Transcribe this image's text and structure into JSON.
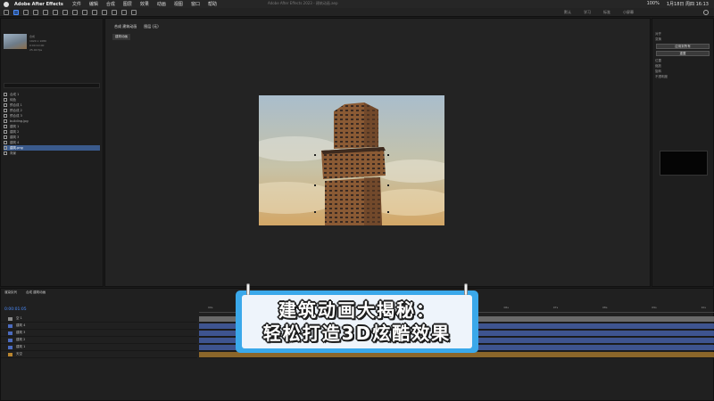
{
  "menubar": {
    "app_name": "Adobe After Effects",
    "items": [
      "文件",
      "编辑",
      "合成",
      "图层",
      "效果",
      "动画",
      "视图",
      "窗口",
      "帮助"
    ],
    "window_title": "Adobe After Effects 2023 - 建筑动画.aep",
    "right_items": [
      "100%",
      "1月18日 周四 16:13"
    ]
  },
  "toolbar": {
    "workspaces": [
      "默认",
      "学习",
      "标准",
      "小屏幕"
    ]
  },
  "project": {
    "meta": [
      "合成",
      "1920 x 1080",
      "0:00:10:00",
      "25.00 fps"
    ],
    "items": [
      "合成 1",
      "纯色",
      "预合成 1",
      "预合成 2",
      "预合成 3",
      "building.jpg",
      "建筑 1",
      "建筑 2",
      "建筑 3",
      "建筑 4",
      "建筑.png",
      "背景"
    ],
    "selected_index": 10
  },
  "composition": {
    "tabs": [
      "合成 建筑动画",
      "图层 (无)"
    ],
    "breadcrumb": "建筑动画",
    "zoom": "50%"
  },
  "properties": {
    "lines": [
      "对齐",
      "变换",
      "位置",
      "缩放",
      "旋转",
      "不透明度"
    ],
    "buttons": [
      "应用到所有",
      "重置"
    ]
  },
  "timeline": {
    "tabs": [
      "渲染队列",
      "合成 建筑动画"
    ],
    "time": "0:00:01:05",
    "ruler": [
      "00s",
      "01s",
      "02s",
      "03s",
      "04s",
      "05s",
      "06s",
      "07s",
      "08s",
      "09s",
      "10s"
    ],
    "layers": [
      {
        "name": "空 1",
        "color": "#8a8a8a"
      },
      {
        "name": "建筑 4",
        "color": "#4b6bbf"
      },
      {
        "name": "建筑 3",
        "color": "#4b6bbf"
      },
      {
        "name": "建筑 2",
        "color": "#4b6bbf"
      },
      {
        "name": "建筑 1",
        "color": "#4b6bbf"
      },
      {
        "name": "天空",
        "color": "#b9852f"
      }
    ]
  },
  "banner": {
    "line1": "建筑动画大揭秘：",
    "line2": "轻松打造3D炫酷效果"
  }
}
